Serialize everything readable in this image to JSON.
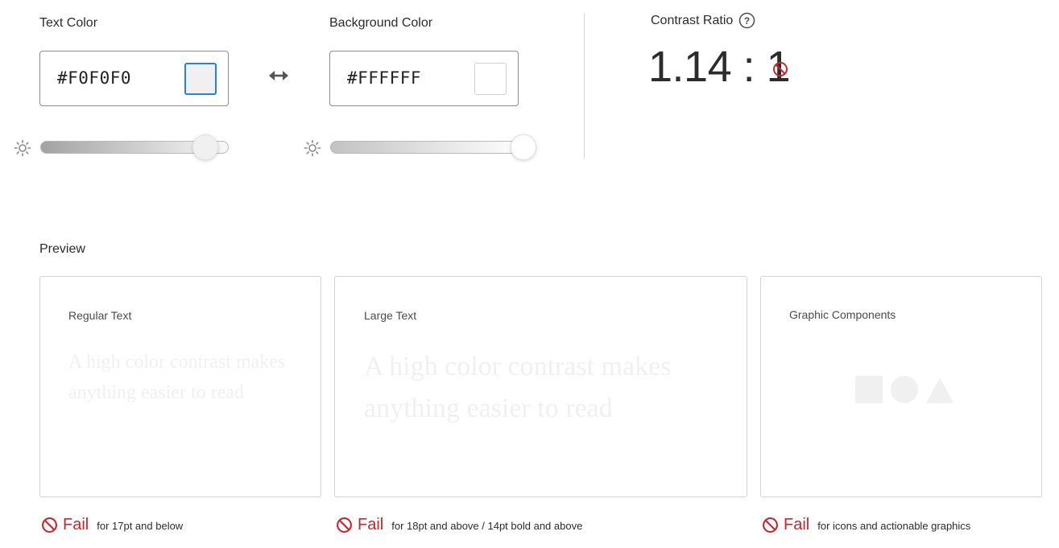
{
  "text_color": {
    "label": "Text Color",
    "value": "#F0F0F0",
    "swatch_color": "#F0F0F0",
    "brightness_level": 0.88
  },
  "swap_icon": "swap-arrows-icon",
  "background_color": {
    "label": "Background Color",
    "value": "#FFFFFF",
    "swatch_color": "#FFFFFF",
    "brightness_level": 1.0
  },
  "contrast": {
    "label": "Contrast Ratio",
    "help_icon": "help-icon",
    "ratio": "1.14 : 1",
    "status_icon": "fail-icon"
  },
  "preview": {
    "heading": "Preview",
    "cards": [
      {
        "title": "Regular Text",
        "sample": "A high color contrast makes anything easier to read",
        "result": "Fail",
        "note": "for 17pt and below"
      },
      {
        "title": "Large Text",
        "sample": "A high color contrast makes anything easier to read",
        "result": "Fail",
        "note": "for 18pt and above / 14pt bold and above"
      },
      {
        "title": "Graphic Components",
        "shapes": [
          "square",
          "circle",
          "triangle"
        ],
        "result": "Fail",
        "note": "for icons and actionable graphics"
      }
    ]
  },
  "colors": {
    "accent": "#2680EB",
    "fail": "#C9252C",
    "text": "#F0F0F0",
    "background": "#FFFFFF"
  }
}
